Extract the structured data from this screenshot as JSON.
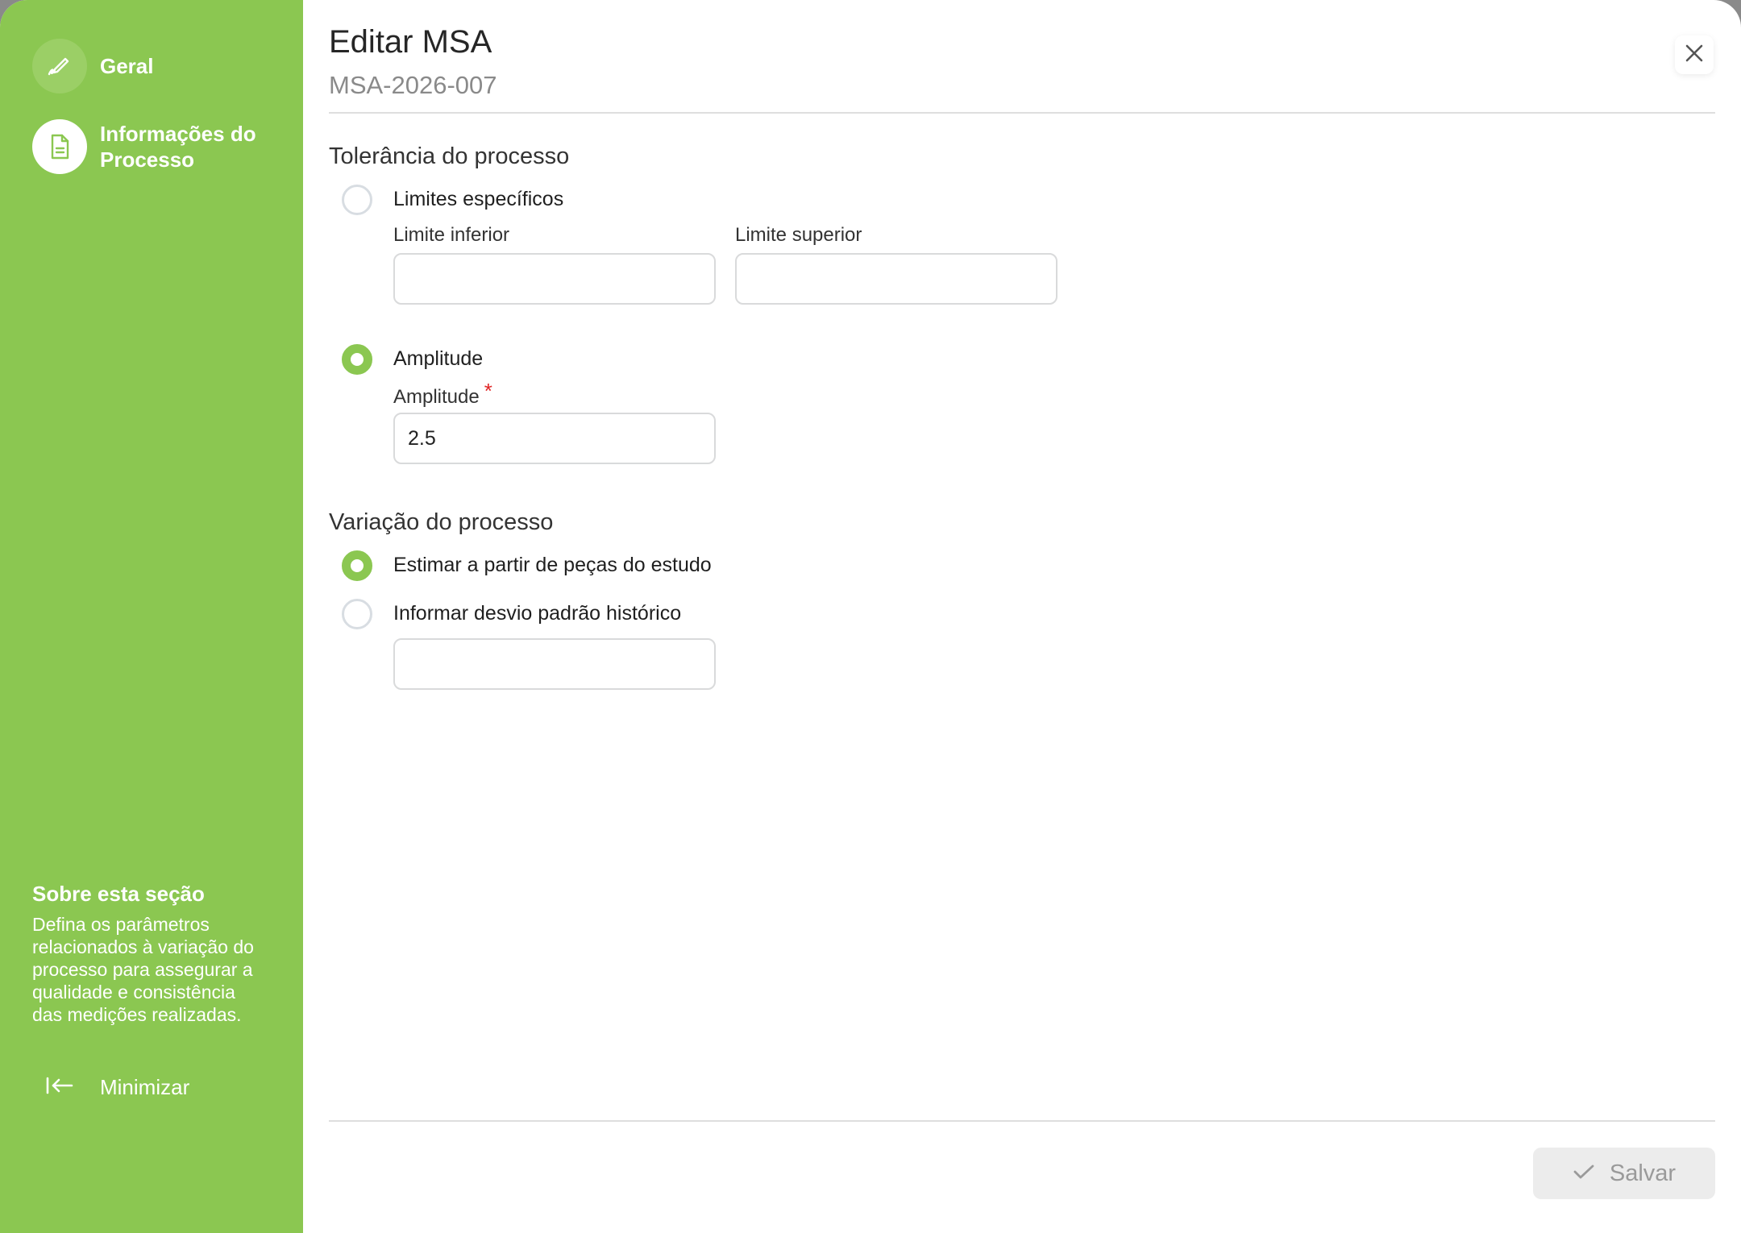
{
  "sidebar": {
    "items": [
      {
        "label": "Geral",
        "icon": "signature-pen-icon"
      },
      {
        "label": "Informações do Processo",
        "icon": "document-icon",
        "active": true
      }
    ],
    "about_title": "Sobre esta seção",
    "about_text": "Defina os parâmetros relacionados à variação do processo para assegurar a qualidade e consistência das medições realizadas.",
    "minimize_label": "Minimizar",
    "minimize_icon": "collapse-left-icon"
  },
  "header": {
    "title": "Editar MSA",
    "subtitle": "MSA-2026-007",
    "close_icon": "close-icon"
  },
  "tolerance": {
    "section_title": "Tolerância do processo",
    "option_limits": {
      "label": "Limites específicos",
      "selected": false
    },
    "lower_limit": {
      "label": "Limite inferior",
      "value": ""
    },
    "upper_limit": {
      "label": "Limite superior",
      "value": ""
    },
    "option_amplitude": {
      "label": "Amplitude",
      "selected": true
    },
    "amplitude": {
      "label": "Amplitude",
      "required_mark": "*",
      "value": "2.5"
    }
  },
  "variation": {
    "section_title": "Variação do processo",
    "option_estimate": {
      "label": "Estimar a partir de peças do estudo",
      "selected": true
    },
    "option_historic": {
      "label": "Informar desvio padrão histórico",
      "selected": false
    },
    "historic_value": ""
  },
  "footer": {
    "save_label": "Salvar",
    "save_icon": "check-icon",
    "save_disabled": true
  },
  "colors": {
    "accent": "#8bc751",
    "sidebar_text": "#ffffff",
    "required": "#e02424"
  }
}
